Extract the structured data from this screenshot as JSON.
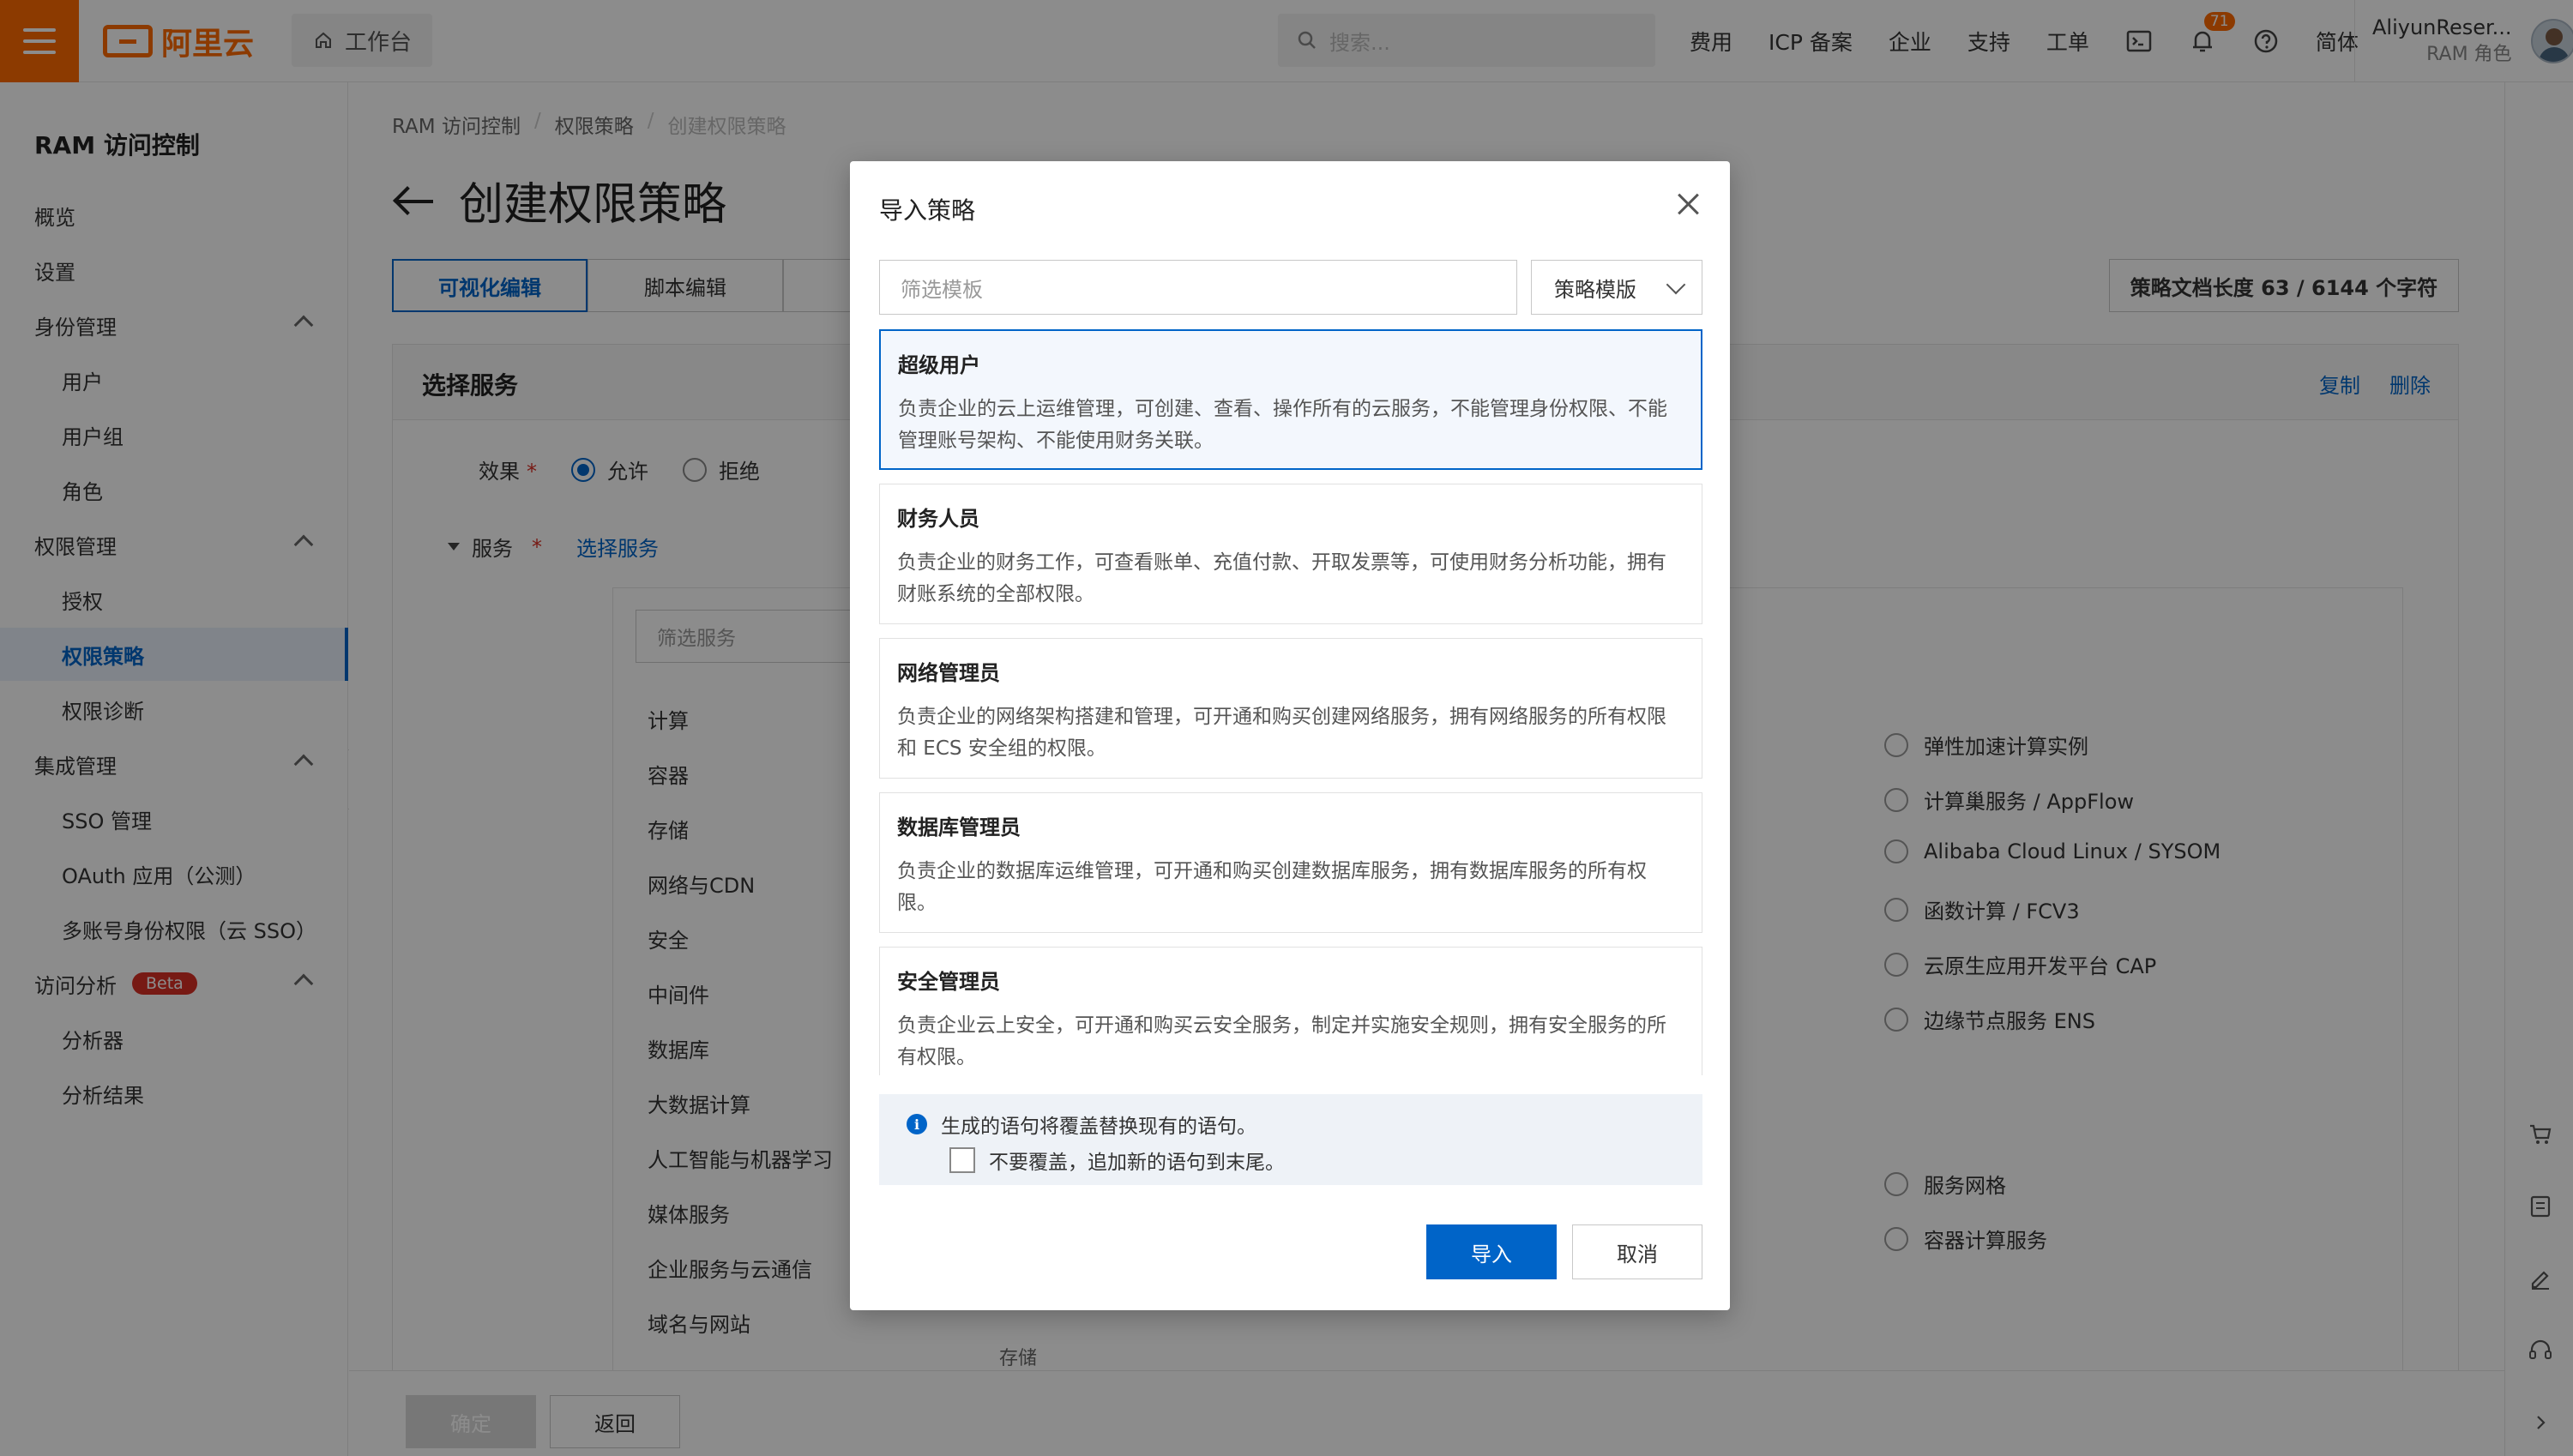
{
  "topbar": {
    "brand": "阿里云",
    "workbench": "工作台",
    "search_placeholder": "搜索...",
    "links": [
      "费用",
      "ICP 备案",
      "企业",
      "支持",
      "工单"
    ],
    "notification_count": "71",
    "language": "简体",
    "user_name": "AliyunReser...",
    "user_role": "RAM 角色"
  },
  "sidebar": {
    "title": "RAM 访问控制",
    "items": [
      {
        "label": "概览"
      },
      {
        "label": "设置"
      },
      {
        "label": "身份管理"
      },
      {
        "label": "用户"
      },
      {
        "label": "用户组"
      },
      {
        "label": "角色"
      },
      {
        "label": "权限管理"
      },
      {
        "label": "授权"
      },
      {
        "label": "权限策略"
      },
      {
        "label": "权限诊断"
      },
      {
        "label": "集成管理"
      },
      {
        "label": "SSO 管理"
      },
      {
        "label": "OAuth 应用（公测）"
      },
      {
        "label": "多账号身份权限（云 SSO）"
      },
      {
        "label": "访问分析"
      },
      {
        "label": "分析器"
      },
      {
        "label": "分析结果"
      }
    ],
    "beta_badge": "Beta"
  },
  "main": {
    "breadcrumb": [
      "RAM 访问控制",
      "权限策略",
      "创建权限策略"
    ],
    "title": "创建权限策略",
    "tabs": [
      "可视化编辑",
      "脚本编辑"
    ],
    "length_button": "策略文档长度 63 / 6144 个字符",
    "panel": {
      "title": "选择服务",
      "copy": "复制",
      "delete": "删除",
      "effect_label": "效果",
      "allow": "允许",
      "deny": "拒绝",
      "service_label": "服务",
      "select_service": "选择服务",
      "service_filter_placeholder": "筛选服务",
      "categories": [
        "计算",
        "容器",
        "存储",
        "网络与CDN",
        "安全",
        "中间件",
        "数据库",
        "大数据计算",
        "人工智能与机器学习",
        "媒体服务",
        "企业服务与云通信",
        "域名与网站"
      ],
      "services": [
        "弹性加速计算实例",
        "计算巢服务 / AppFlow",
        "Alibaba Cloud Linux / SYSOM",
        "函数计算 / FCV3",
        "云原生应用开发平台 CAP",
        "边缘节点服务 ENS",
        "服务网格",
        "容器计算服务"
      ],
      "peek_text": "存储"
    },
    "confirm": "确定",
    "back": "返回"
  },
  "modal": {
    "title": "导入策略",
    "filter_placeholder": "筛选模板",
    "select_value": "策略模版",
    "templates": [
      {
        "name": "超级用户",
        "desc": "负责企业的云上运维管理，可创建、查看、操作所有的云服务，不能管理身份权限、不能管理账号架构、不能使用财务关联。"
      },
      {
        "name": "财务人员",
        "desc": "负责企业的财务工作，可查看账单、充值付款、开取发票等，可使用财务分析功能，拥有财账系统的全部权限。"
      },
      {
        "name": "网络管理员",
        "desc": "负责企业的网络架构搭建和管理，可开通和购买创建网络服务，拥有网络服务的所有权限和 ECS 安全组的权限。"
      },
      {
        "name": "数据库管理员",
        "desc": "负责企业的数据库运维管理，可开通和购买创建数据库服务，拥有数据库服务的所有权限。"
      },
      {
        "name": "安全管理员",
        "desc": "负责企业云上安全，可开通和购买云安全服务，制定并实施安全规则，拥有安全服务的所有权限。"
      }
    ],
    "notice": "生成的语句将覆盖替换现有的语句。",
    "append_option": "不要覆盖，追加新的语句到末尾。",
    "import": "导入",
    "cancel": "取消"
  }
}
